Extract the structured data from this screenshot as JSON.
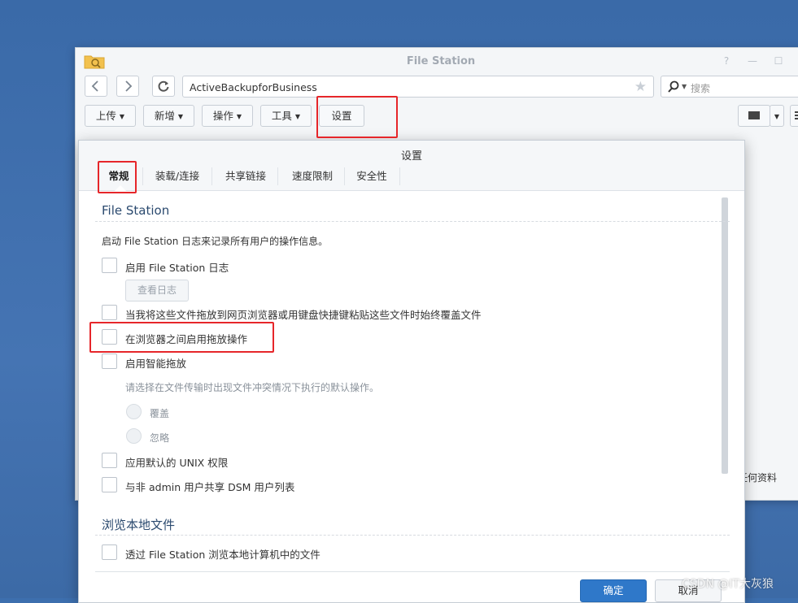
{
  "window": {
    "title": "File Station",
    "path": "ActiveBackupforBusiness",
    "search_placeholder": "搜索",
    "toolbar": {
      "upload": "上传",
      "create": "新增",
      "action": "操作",
      "tools": "工具",
      "settings": "设置"
    },
    "side_fragment": "任何资料"
  },
  "dialog": {
    "title": "设置",
    "tabs": [
      "常规",
      "装载/连接",
      "共享链接",
      "速度限制",
      "安全性"
    ],
    "section1": {
      "title": "File Station",
      "description": "启动 File Station 日志来记录所有用户的操作信息。",
      "enable_log": "启用 File Station 日志",
      "view_log": "查看日志",
      "overwrite_option": "当我将这些文件拖放到网页浏览器或用键盘快捷键粘贴这些文件时始终覆盖文件",
      "drag_between_browsers": "在浏览器之间启用拖放操作",
      "smart_drag": "启用智能拖放",
      "conflict_hint": "请选择在文件传输时出现文件冲突情况下执行的默认操作。",
      "radio_overwrite": "覆盖",
      "radio_skip": "忽略",
      "unix_permissions": "应用默认的 UNIX 权限",
      "share_dsm_list": "与非 admin 用户共享 DSM 用户列表"
    },
    "section2": {
      "title": "浏览本地文件",
      "browse_local": "透过 File Station 浏览本地计算机中的文件"
    },
    "ok": "确定",
    "cancel": "取消"
  },
  "watermark": "CSDN @IT大灰狼",
  "colors": {
    "desktop": "#3d6fae",
    "accent": "#2f78c9",
    "highlight": "#e6262a"
  }
}
